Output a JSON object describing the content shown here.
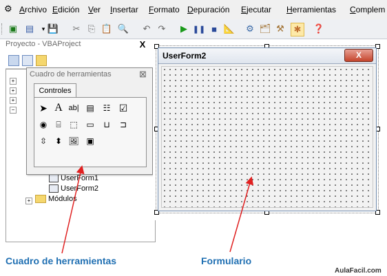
{
  "menubar": {
    "items": [
      "Archivo",
      "Edición",
      "Ver",
      "Insertar",
      "Formato",
      "Depuración",
      "Ejecutar",
      "Herramientas",
      "Complem"
    ]
  },
  "project_explorer": {
    "title": "Proyecto - VBAProject",
    "close_label": "X",
    "tree": {
      "userform1": "UserForm1",
      "userform2": "UserForm2",
      "modulos": "Módulos"
    }
  },
  "toolbox": {
    "title": "Cuadro de herramientas",
    "close_label": "⊠",
    "tab_label": "Controles"
  },
  "form": {
    "title": "UserForm2",
    "close_label": "X"
  },
  "annotations": {
    "toolbox_label": "Cuadro de herramientas",
    "form_label": "Formulario",
    "watermark": "AulaFacil.com"
  },
  "colors": {
    "annotation": "#1f6fb2",
    "arrow": "#e02020"
  }
}
